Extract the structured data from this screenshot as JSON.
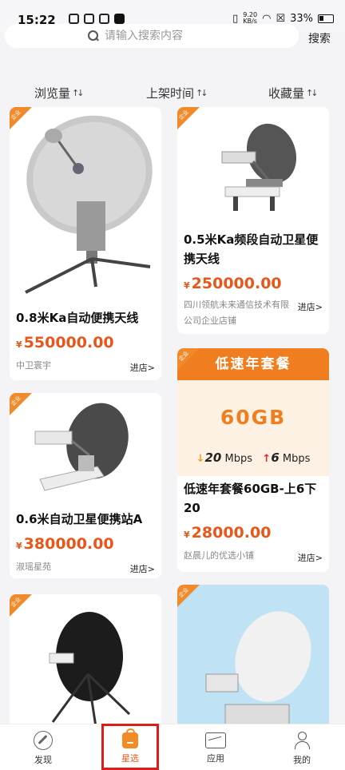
{
  "status": {
    "time": "15:22",
    "speed_value": "9.20",
    "speed_unit": "KB/s",
    "battery": "33%"
  },
  "search": {
    "placeholder": "请输入搜索内容",
    "button": "搜索"
  },
  "sort": [
    {
      "label": "浏览量"
    },
    {
      "label": "上架时间"
    },
    {
      "label": "收藏量"
    }
  ],
  "badge": "企业",
  "products": [
    {
      "title": "0.8米Ka自动便携天线",
      "currency": "¥",
      "price": "550000.00",
      "shop": "中卫寰宇",
      "enter": "进店>"
    },
    {
      "title": "0.5米Ka频段自动卫星便携天线",
      "currency": "¥",
      "price": "250000.00",
      "shop": "四川领航未来通信技术有限公司企业店铺",
      "enter": "进店>"
    },
    {
      "title": "0.6米自动卫星便携站A",
      "currency": "¥",
      "price": "380000.00",
      "shop": "淑瑶星苑",
      "enter": "进店>"
    },
    {
      "title": "低速年套餐60GB-上6下20",
      "currency": "¥",
      "price": "28000.00",
      "shop": "赵晨儿的优选小铺",
      "enter": "进店>"
    }
  ],
  "plan_banner": {
    "heading": "低速年套餐",
    "data": "60GB",
    "down_value": "20",
    "up_value": "6",
    "unit": "Mbps"
  },
  "tabs": [
    {
      "label": "发现",
      "icon": "compass-icon"
    },
    {
      "label": "星选",
      "icon": "shopping-bag-icon"
    },
    {
      "label": "应用",
      "icon": "chart-icon"
    },
    {
      "label": "我的",
      "icon": "user-icon"
    }
  ],
  "colors": {
    "accent": "#e8561a",
    "tag": "#f08a2a",
    "active_outline": "#e01919"
  }
}
